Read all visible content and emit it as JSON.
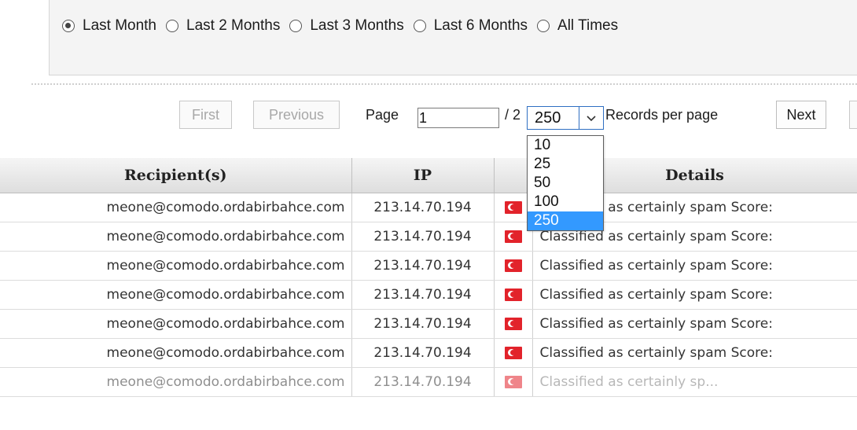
{
  "filter": {
    "options": [
      {
        "label": "Last Month",
        "checked": true
      },
      {
        "label": "Last 2 Months",
        "checked": false
      },
      {
        "label": "Last 3 Months",
        "checked": false
      },
      {
        "label": "Last 6 Months",
        "checked": false
      },
      {
        "label": "All Times",
        "checked": false
      }
    ]
  },
  "pager": {
    "first_label": "First",
    "previous_label": "Previous",
    "page_label": "Page",
    "page_value": "1",
    "total_pages_text": "/ 2",
    "records_selected": "250",
    "records_label": "Records per page",
    "next_label": "Next",
    "records_options": [
      "10",
      "25",
      "50",
      "100",
      "250"
    ]
  },
  "table": {
    "columns": {
      "recipient": "Recipient(s)",
      "ip": "IP",
      "flag": "",
      "details": "Details"
    },
    "rows": [
      {
        "recipient": "meone@comodo.ordabirbahce.com",
        "ip": "213.14.70.194",
        "details": "Classified as certainly spam Score:"
      },
      {
        "recipient": "meone@comodo.ordabirbahce.com",
        "ip": "213.14.70.194",
        "details": "Classified as certainly spam Score:"
      },
      {
        "recipient": "meone@comodo.ordabirbahce.com",
        "ip": "213.14.70.194",
        "details": "Classified as certainly spam Score:"
      },
      {
        "recipient": "meone@comodo.ordabirbahce.com",
        "ip": "213.14.70.194",
        "details": "Classified as certainly spam Score:"
      },
      {
        "recipient": "meone@comodo.ordabirbahce.com",
        "ip": "213.14.70.194",
        "details": "Classified as certainly spam Score:"
      },
      {
        "recipient": "meone@comodo.ordabirbahce.com",
        "ip": "213.14.70.194",
        "details": "Classified as certainly spam Score:"
      },
      {
        "recipient": "meone@comodo.ordabirbahce.com",
        "ip": "213.14.70.194",
        "details": "Classified as certainly sp..."
      }
    ],
    "flag_icon": "turkey-flag-icon",
    "flag_color": "#e2232b"
  },
  "colors": {
    "selected_option_bg": "#3399ff",
    "select_border": "#2f6fc2"
  }
}
